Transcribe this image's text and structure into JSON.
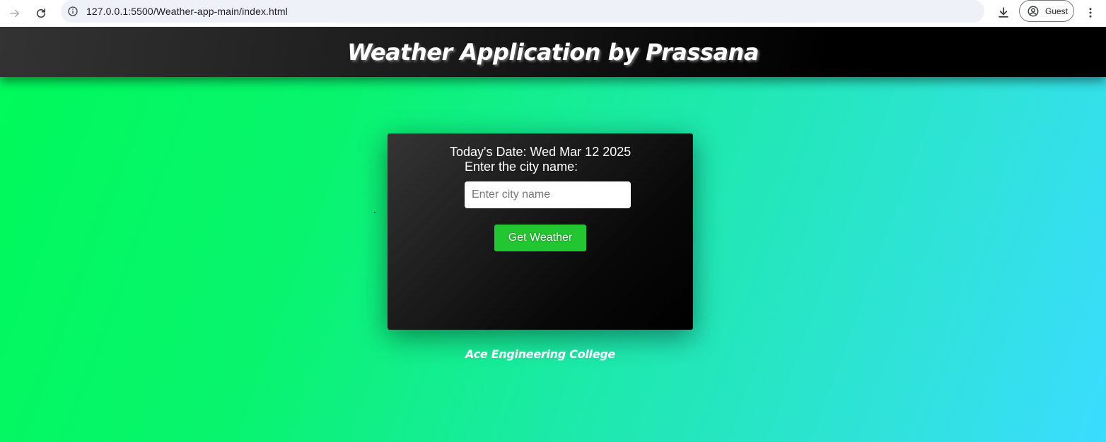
{
  "browser": {
    "url": "127.0.0.1:5500/Weather-app-main/index.html",
    "profile_label": "Guest",
    "icons": {
      "forward": "arrow-right-icon",
      "reload": "reload-icon",
      "info": "info-icon",
      "download": "download-icon",
      "profile": "person-circle-icon",
      "menu": "kebab-menu-icon"
    }
  },
  "header": {
    "title": "Weather Application by Prassana"
  },
  "card": {
    "date_line": "Today's Date: Wed Mar 12 2025",
    "city_label": "Enter the city name:",
    "city_input": {
      "value": "",
      "placeholder": "Enter city name"
    },
    "button_label": "Get Weather"
  },
  "footer": {
    "text": "Ace Engineering College"
  },
  "colors": {
    "gradient_start": "#00fa5a",
    "gradient_end": "#3bdcff",
    "header_bg": "#000000",
    "card_bg": "#000000",
    "button_bg": "#22c630"
  }
}
